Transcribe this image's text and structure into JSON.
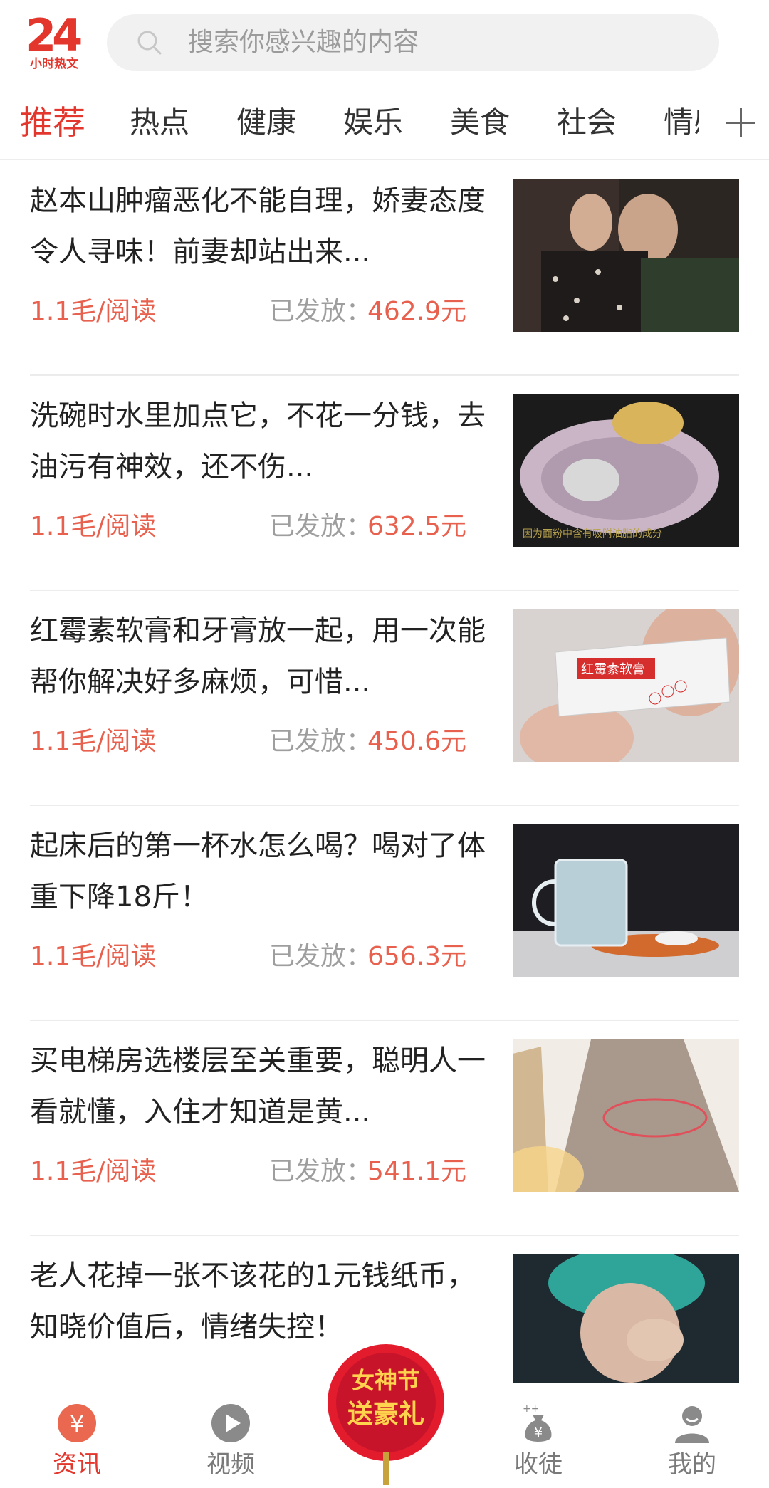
{
  "header": {
    "logo_number": "24",
    "logo_text": "小时热文",
    "search_placeholder": "搜索你感兴趣的内容"
  },
  "tabs": [
    "推荐",
    "热点",
    "健康",
    "娱乐",
    "美食",
    "社会",
    "情感"
  ],
  "feed": [
    {
      "title": "赵本山肿瘤恶化不能自理，娇妻态度令人寻味！前妻却站出来...",
      "rate": "1.1毛/阅读",
      "paid_label": "已发放：",
      "paid_value": "462.9元"
    },
    {
      "title": "洗碗时水里加点它，不花一分钱，去油污有神效，还不伤...",
      "rate": "1.1毛/阅读",
      "paid_label": "已发放：",
      "paid_value": "632.5元",
      "image_caption": "因为面粉中含有吸附油脂的成分"
    },
    {
      "title": "红霉素软膏和牙膏放一起，用一次能帮你解决好多麻烦，可惜...",
      "rate": "1.1毛/阅读",
      "paid_label": "已发放：",
      "paid_value": "450.6元",
      "image_text": "红霉素软膏"
    },
    {
      "title": "起床后的第一杯水怎么喝？喝对了体重下降18斤！",
      "rate": "1.1毛/阅读",
      "paid_label": "已发放：",
      "paid_value": "656.3元"
    },
    {
      "title": "买电梯房选楼层至关重要，聪明人一看就懂，入住才知道是黄...",
      "rate": "1.1毛/阅读",
      "paid_label": "已发放：",
      "paid_value": "541.1元"
    },
    {
      "title": "老人花掉一张不该花的1元钱纸币，知晓价值后，情绪失控！"
    }
  ],
  "nav": [
    {
      "label": "资讯"
    },
    {
      "label": "视频"
    },
    {
      "label": "收徒"
    },
    {
      "label": "我的"
    }
  ],
  "promo": {
    "line1": "女神节",
    "line2": "送豪礼"
  },
  "colors": {
    "accent": "#e3362c",
    "price": "#e8614f",
    "muted": "#9e9e9e"
  }
}
